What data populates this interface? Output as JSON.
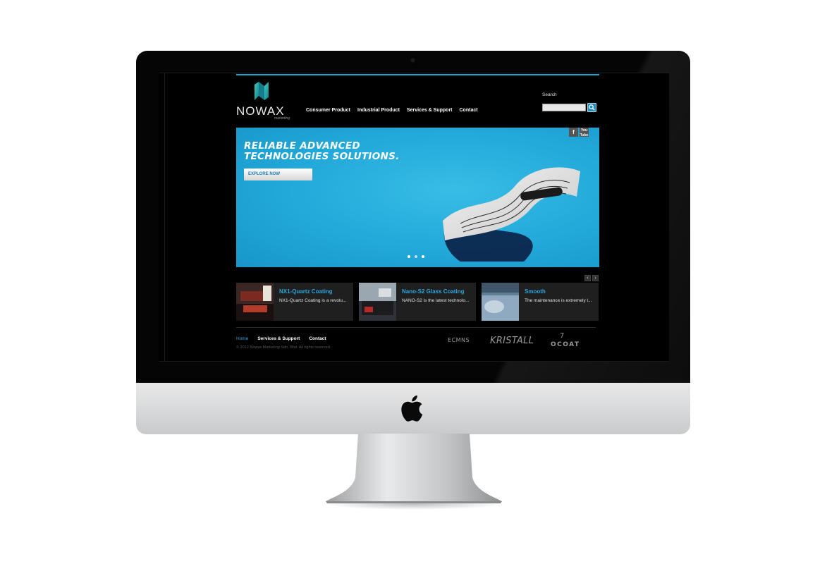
{
  "site": {
    "logo_text": "NOWAX",
    "logo_sub": "marketing",
    "nav": [
      {
        "label": "Consumer Product"
      },
      {
        "label": "Industrial Product"
      },
      {
        "label": "Services & Support"
      },
      {
        "label": "Contact"
      }
    ],
    "search": {
      "label": "Search",
      "value": ""
    }
  },
  "hero": {
    "title": "RELIABLE ADVANCED TECHNOLOGIES SOLUTIONS.",
    "cta": "EXPLORE NOW",
    "slides": 3,
    "active_slide": 1
  },
  "social": {
    "facebook": "f",
    "youtube": "You Tube"
  },
  "carousel": {
    "prev": "‹",
    "next": "›"
  },
  "products": [
    {
      "title": "NX1-Quartz Coating",
      "desc": "NX1-Quartz Coating is a revolu..."
    },
    {
      "title": "Nano-S2 Glass Coating",
      "desc": "NANO-S2 is the latest technolo..."
    },
    {
      "title": "Smooth",
      "desc": "The maintenance is extremely l..."
    }
  ],
  "footer": {
    "links": [
      {
        "label": "Home",
        "active": true
      },
      {
        "label": "Services & Support",
        "active": false
      },
      {
        "label": "Contact",
        "active": false
      }
    ],
    "copyright": "© 2012 Nowax Marketing Sdn. Bhd. All rights reserved.",
    "brands": [
      "ECMNS",
      "KRISTALL",
      "OCOAT"
    ],
    "brand_7": "7"
  },
  "colors": {
    "accent": "#19a3d8",
    "hero_bg": "#22a8d9",
    "screen_bg": "#000000"
  },
  "icons": [
    "search-icon",
    "facebook-icon",
    "youtube-icon",
    "apple-logo-icon"
  ]
}
